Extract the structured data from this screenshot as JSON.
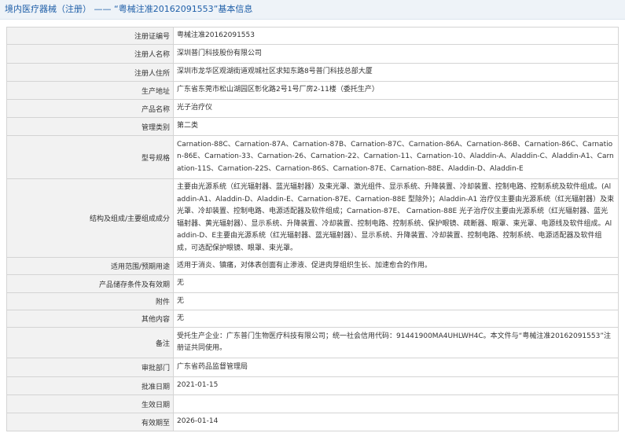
{
  "header": {
    "category": "境内医疗器械（注册）",
    "separator": "——",
    "subject": "“粤械注准20162091553”基本信息"
  },
  "rows": [
    {
      "label": "注册证编号",
      "value": "粤械注准20162091553"
    },
    {
      "label": "注册人名称",
      "value": "深圳普门科技股份有限公司"
    },
    {
      "label": "注册人住所",
      "value": "深圳市龙华区观湖街道观城社区求知东路8号普门科技总部大厦"
    },
    {
      "label": "生产地址",
      "value": "广东省东莞市松山湖园区彰化路2号1号厂房2-11楼（委托生产）"
    },
    {
      "label": "产品名称",
      "value": "光子治疗仪"
    },
    {
      "label": "管理类别",
      "value": "第二类"
    },
    {
      "label": "型号规格",
      "value": "Carnation-88C、Carnation-87A、Carnation-87B、Carnation-87C、Carnation-86A、Carnation-86B、Carnation-86C、Carnation-86E、Carnation-33、Carnation-26、Carnation-22、Carnation-11、Carnation-10、Aladdin-A、Aladdin-C、Aladdin-A1、Carnation-11S、Carnation-22S、Carnation-86S、Carnation-87E、Carnation-88E、Aladdin-D、Aladdin-E"
    },
    {
      "label": "结构及组成/主要组成成分",
      "value": "主要由光源系统（红光辐射器、蓝光辐射器）及束光罩、激光组件、显示系统、升降装置、冷却装置、控制电路、控制系统及软件组成。(Aladdin-A1、Aladdin-D、Aladdin-E、Carnation-87E、Carnation-88E 型除外)；Aladdin-A1 治疗仪主要由光源系统（红光辐射器）及束光罩、冷却装置、控制电路、电源适配器及软件组成；Carnation-87E、 Carnation-88E 光子治疗仪主要由光源系统（红光辐射器、蓝光辐射器、黄光辐射器）、显示系统、升降装置、冷却装置、控制电路、控制系统、保护眼镜、疏断器、眼罩、束光罩、电源线及软件组成。Aladdin-D、E主要由光源系统（红光辐射器、蓝光辐射器）、显示系统、升降装置、冷却装置、控制电路、控制系统、电源适配器及软件组成，可选配保护眼镜、眼罩、束光罩。"
    },
    {
      "label": "适用范围/预期用途",
      "value": "适用于消炎、镇痛，对体表创面有止渗液、促进肉芽组织生长、加速愈合的作用。"
    },
    {
      "label": "产品储存条件及有效期",
      "value": "无"
    },
    {
      "label": "附件",
      "value": "无"
    },
    {
      "label": "其他内容",
      "value": "无"
    },
    {
      "label": "备注",
      "value": "受托生产企业：广东普门生物医疗科技有限公司；统一社会信用代码：91441900MA4UHLWH4C。本文件与“粤械注准20162091553”注册证共同使用。"
    },
    {
      "label": "审批部门",
      "value": "广东省药品监督管理局"
    },
    {
      "label": "批准日期",
      "value": "2021-01-15"
    },
    {
      "label": "生效日期",
      "value": ""
    },
    {
      "label": "有效期至",
      "value": "2026-01-14"
    }
  ]
}
